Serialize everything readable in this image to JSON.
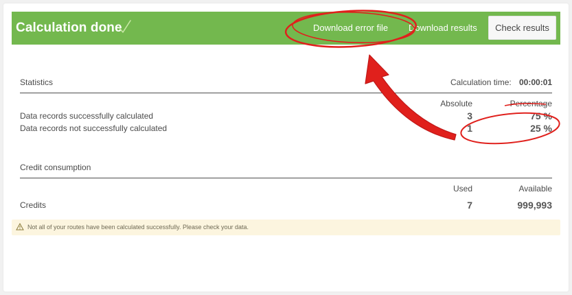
{
  "header": {
    "title": "Calculation done",
    "download_error_label": "Download error file",
    "download_results_label": "Download results",
    "check_results_label": "Check results",
    "brand_color": "#73b84e"
  },
  "statistics": {
    "section_title": "Statistics",
    "calc_time_label": "Calculation time:",
    "calc_time_value": "00:00:01",
    "col_absolute": "Absolute",
    "col_percentage": "Percentage",
    "rows": [
      {
        "label": "Data records successfully calculated",
        "absolute": "3",
        "percentage": "75 %"
      },
      {
        "label": "Data records not successfully calculated",
        "absolute": "1",
        "percentage": "25 %"
      }
    ]
  },
  "credits": {
    "section_title": "Credit consumption",
    "col_used": "Used",
    "col_available": "Available",
    "row_label": "Credits",
    "used": "7",
    "available": "999,993"
  },
  "warning": {
    "icon": "warning-triangle-icon",
    "text": "Not all of your routes have been calculated successfully. Please check your data.",
    "bg_color": "#fcf5df"
  },
  "annotation": {
    "color": "#e0201c"
  }
}
